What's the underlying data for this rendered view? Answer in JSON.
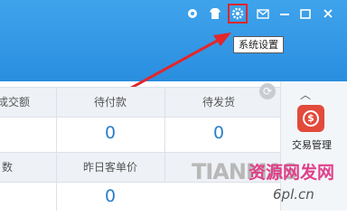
{
  "titlebar": {
    "icons": [
      "bell-icon",
      "shirt-icon",
      "gear-icon",
      "mail-icon",
      "minimize-icon",
      "maximize-icon",
      "close-icon"
    ]
  },
  "tooltip": {
    "text": "系统设置"
  },
  "stats": {
    "row1": [
      {
        "label": "成交额",
        "value": ""
      },
      {
        "label": "待付款",
        "value": "0"
      },
      {
        "label": "待发货",
        "value": "0"
      }
    ],
    "row2": [
      {
        "label": "数",
        "value": ""
      },
      {
        "label": "昨日客单价",
        "value": "0"
      }
    ]
  },
  "sidebar": {
    "item_label": "交易管理",
    "coin_symbol": "$"
  },
  "watermark": {
    "text_en": "TIANMAS",
    "text_cn": "资源网发网",
    "url": "6pl.cn"
  },
  "colors": {
    "titlebar": "#3fa3ec",
    "highlight_box": "#e4262a",
    "arrow": "#e4262a",
    "value": "#2a7fc9"
  }
}
